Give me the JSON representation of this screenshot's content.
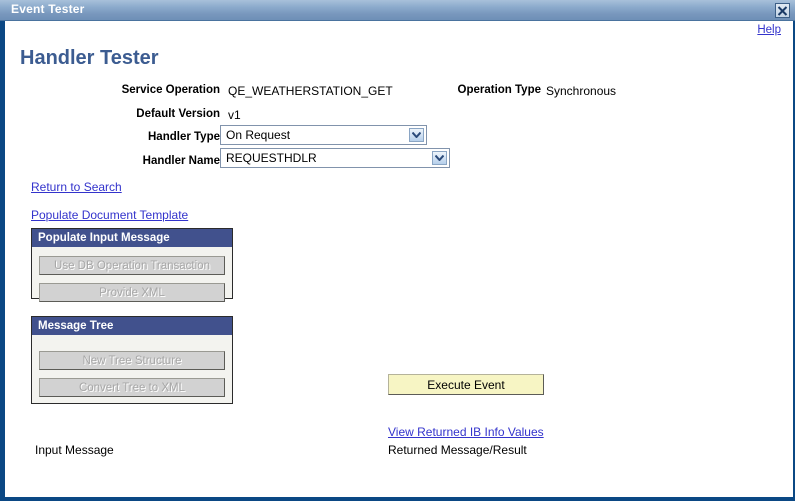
{
  "window": {
    "title": "Event Tester",
    "close_icon": "close-x-icon",
    "border_color": "#0b4884",
    "titlebar_color": "#7897bd"
  },
  "header": {
    "help_label": "Help",
    "page_title": "Handler Tester"
  },
  "form": {
    "service_operation": {
      "label": "Service Operation",
      "value": "QE_WEATHERSTATION_GET"
    },
    "operation_type": {
      "label": "Operation Type",
      "value": "Synchronous"
    },
    "default_version": {
      "label": "Default Version",
      "value": "v1"
    },
    "handler_type": {
      "label": "Handler Type",
      "value": "On Request",
      "arrow_icon": "chevron-down-icon"
    },
    "handler_name": {
      "label": "Handler Name",
      "value": "REQUESTHDLR",
      "arrow_icon": "chevron-down-icon"
    }
  },
  "links": {
    "return_to_search": "Return to Search",
    "populate_document_template": "Populate Document Template",
    "view_returned_ib_info_values": "View Returned IB Info Values",
    "color": "#3333cc"
  },
  "groups": [
    {
      "title": "Populate Input Message",
      "buttons": [
        {
          "label": "Use DB Operation Transaction",
          "enabled": false
        },
        {
          "label": "Provide XML",
          "enabled": false
        }
      ]
    },
    {
      "title": "Message Tree",
      "buttons": [
        {
          "label": "New Tree Structure",
          "enabled": false
        },
        {
          "label": "Convert Tree to XML",
          "enabled": false
        }
      ]
    }
  ],
  "group_header_color": "#41518d",
  "actions": {
    "execute_event": {
      "label": "Execute Event",
      "background": "#f7f5c4"
    }
  },
  "captions": {
    "input_message": "Input Message",
    "returned_message_result": "Returned Message/Result"
  }
}
